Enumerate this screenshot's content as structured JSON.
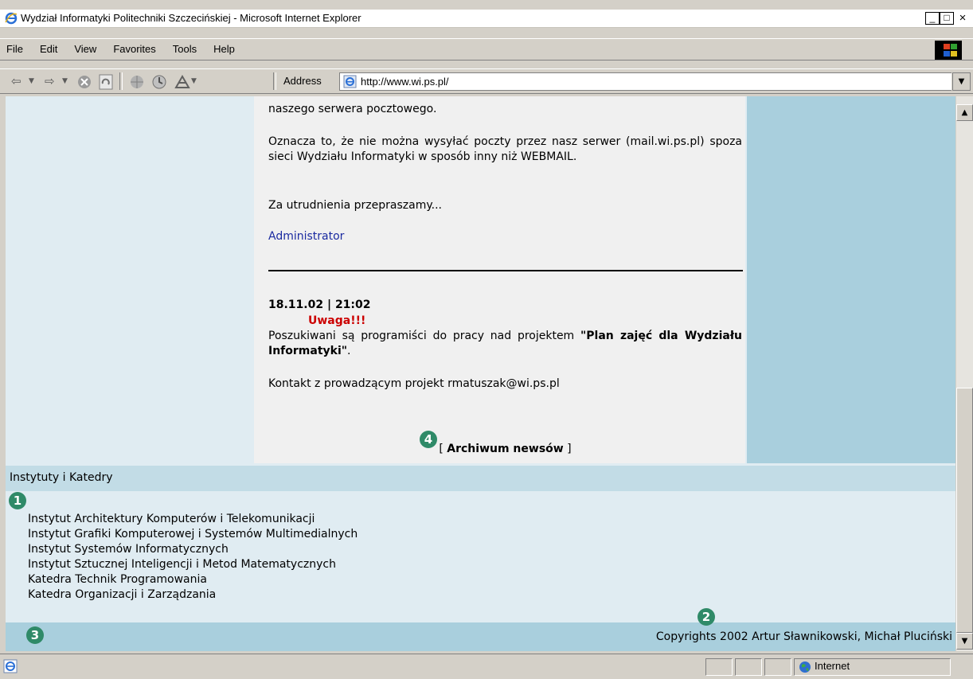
{
  "window": {
    "title": "Wydział Informatyki Politechniki Szczecińskiej - Microsoft Internet Explorer",
    "controls": {
      "minimize": "_",
      "maximize": "□",
      "close": "×"
    }
  },
  "menu": {
    "items": [
      {
        "label": "File"
      },
      {
        "label": "Edit"
      },
      {
        "label": "View"
      },
      {
        "label": "Favorites"
      },
      {
        "label": "Tools"
      },
      {
        "label": "Help"
      }
    ]
  },
  "toolbar": {
    "back_icon": "back-arrow-icon",
    "forward_icon": "forward-arrow-icon",
    "stop_icon": "stop-icon",
    "refresh_icon": "refresh-icon",
    "home_icon": "home-icon",
    "history_icon": "history-icon",
    "address_label": "Address",
    "address_value": "http://www.wi.ps.pl/"
  },
  "news": {
    "para1": "naszego serwera pocztowego.",
    "para2": "Oznacza to, że nie można wysyłać poczty przez nasz serwer (mail.wi.ps.pl) spoza sieci Wydziału Informatyki w sposób inny niż WEBMAIL.",
    "para3": "Za utrudnienia przepraszamy...",
    "signature": "Administrator",
    "item2_date": "18.11.02 | 21:02",
    "item2_alert": "Uwaga!!!",
    "item2_text_before": "Poszukiwani są programiści do pracy nad projektem ",
    "item2_project": "\"Plan zajęć dla Wydziału Informatyki\"",
    "item2_text_after": ".",
    "item2_contact": "Kontakt z prowadzącym projekt rmatuszak@wi.ps.pl",
    "archive_open": "[ ",
    "archive_link": "Archiwum newsów",
    "archive_close": " ]"
  },
  "institutes": {
    "heading": "Instytuty i Katedry",
    "items": [
      "Instytut Architektury Komputerów i Telekomunikacji",
      "Instytut Grafiki Komputerowej i Systemów Multimedialnych",
      "Instytut Systemów Informatycznych",
      "Instytut Sztucznej Inteligencji i Metod Matematycznych",
      "Katedra Technik Programowania",
      "Katedra Organizacji i Zarządzania"
    ]
  },
  "footer": {
    "copyright": "Copyrights 2002 Artur Sławnikowski, Michał Pluciński"
  },
  "markers": [
    "1",
    "2",
    "3",
    "4"
  ],
  "statusbar": {
    "zone": "Internet"
  },
  "colors": {
    "left_column": "#e0ecf2",
    "center_column": "#f0f0f0",
    "right_column": "#a9cfdd",
    "section_header": "#c2dce6",
    "alert": "#cc0000",
    "link": "#1a2aa0",
    "marker": "#2f8a68"
  }
}
